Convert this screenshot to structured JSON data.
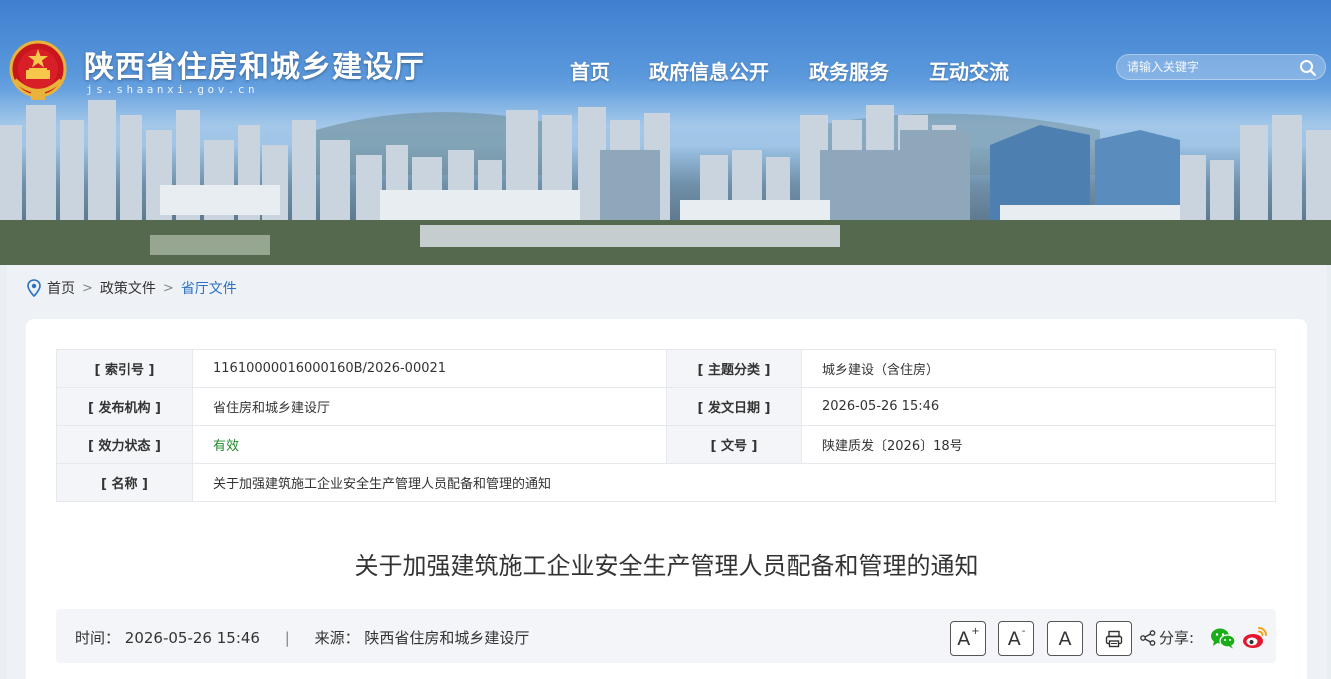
{
  "header": {
    "site_title": "陕西省住房和城乡建设厅",
    "site_domain": "js.shaanxi.gov.cn",
    "nav": [
      {
        "label": "首页"
      },
      {
        "label": "政府信息公开"
      },
      {
        "label": "政务服务"
      },
      {
        "label": "互动交流"
      }
    ],
    "search": {
      "placeholder": "请输入关键字",
      "icon": "search-icon"
    }
  },
  "breadcrumb": {
    "icon": "location-pin-icon",
    "items": [
      "首页",
      "政策文件",
      "省厅文件"
    ],
    "separator": ">"
  },
  "meta": {
    "index_no": {
      "label": "[ 索引号 ]",
      "value": "11610000016000160B/2026-00021"
    },
    "topic": {
      "label": "[ 主题分类 ]",
      "value": "城乡建设（含住房）"
    },
    "publisher": {
      "label": "[ 发布机构 ]",
      "value": "省住房和城乡建设厅"
    },
    "issue_date": {
      "label": "[ 发文日期 ]",
      "value": "2026-05-26 15:46"
    },
    "status": {
      "label": "[ 效力状态 ]",
      "value": "有效",
      "color": "#1f8a2b"
    },
    "doc_no": {
      "label": "[ 文号 ]",
      "value": "陕建质发〔2026〕18号"
    },
    "name": {
      "label": "[ 名称 ]",
      "value": "关于加强建筑施工企业安全生产管理人员配备和管理的通知"
    }
  },
  "article": {
    "title": "关于加强建筑施工企业安全生产管理人员配备和管理的通知"
  },
  "infobar": {
    "time_label": "时间：",
    "time_value": "2026-05-26 15:46",
    "divider": "|",
    "source_label": "来源：",
    "source_value": "陕西省住房和城乡建设厅",
    "font_buttons": {
      "larger": "A",
      "larger_sup": "+",
      "smaller": "A",
      "smaller_sup": "-",
      "reset": "A"
    },
    "share_label": "分享:",
    "icons": [
      "print-icon",
      "share-icon",
      "wechat-icon",
      "weibo-icon"
    ]
  },
  "colors": {
    "accent": "#2a72c1",
    "status_green": "#1f8a2b",
    "weibo_red": "#e6162d",
    "wechat_green": "#1aad19"
  }
}
